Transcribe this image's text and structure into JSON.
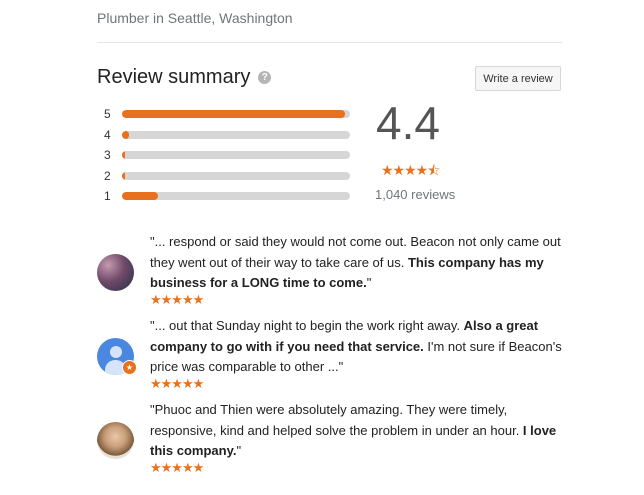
{
  "header": {
    "subtitle": "Plumber in Seattle, Washington"
  },
  "summary": {
    "title": "Review summary",
    "help_icon": "help-icon",
    "write_review_label": "Write a review",
    "score": "4.4",
    "score_stars": "★★★★⯪",
    "review_count": "1,040 reviews",
    "accent_color": "#e8711e",
    "histogram": [
      {
        "label": "5",
        "fraction": 0.98
      },
      {
        "label": "4",
        "fraction": 0.03
      },
      {
        "label": "3",
        "fraction": 0.01
      },
      {
        "label": "2",
        "fraction": 0.01
      },
      {
        "label": "1",
        "fraction": 0.16
      }
    ]
  },
  "reviews": [
    {
      "avatar": "photo-avatar",
      "text_plain": "\"... respond or said they would not come out. Beacon not only came out they went out of their way to take care of us. ",
      "text_bold": "This company has my business for a LONG time to come.",
      "text_tail": "\"",
      "stars": "★★★★★"
    },
    {
      "avatar": "generic-user-avatar",
      "text_plain": "\"... out that Sunday night to begin the work right away. ",
      "text_bold": "Also a great company to go with if you need that service.",
      "text_tail": " I'm not sure if Beacon's price was comparable to other ...\"",
      "stars": "★★★★★"
    },
    {
      "avatar": "photo-avatar",
      "text_plain": "\"Phuoc and Thien were absolutely amazing. They were timely, responsive, kind and helped solve the problem in under an hour. ",
      "text_bold": "I love this company.",
      "text_tail": "\"",
      "stars": "★★★★★"
    }
  ]
}
